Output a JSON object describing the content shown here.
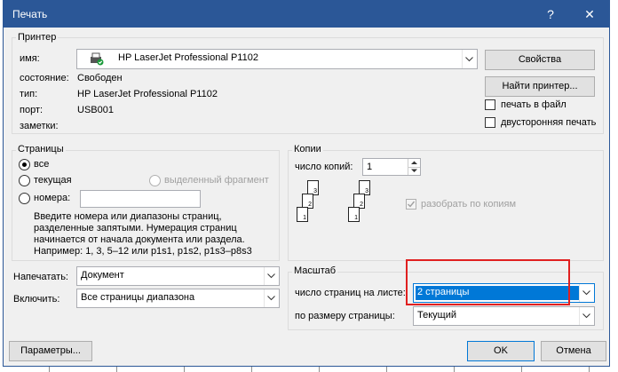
{
  "window": {
    "title": "Печать",
    "help": "?",
    "close": "✕"
  },
  "printer": {
    "group_title": "Принтер",
    "name_label": "имя:",
    "name_value": "HP LaserJet Professional P1102",
    "status_label": "состояние:",
    "status_value": "Свободен",
    "type_label": "тип:",
    "type_value": "HP LaserJet Professional P1102",
    "port_label": "порт:",
    "port_value": "USB001",
    "notes_label": "заметки:",
    "properties_button": "Свойства",
    "find_button": "Найти принтер...",
    "print_to_file_label": "печать в файл",
    "duplex_label": "двусторонняя печать"
  },
  "pages": {
    "group_title": "Страницы",
    "all_label": "все",
    "current_label": "текущая",
    "selection_label": "выделенный фрагмент",
    "numbers_label": "номера:",
    "numbers_value": "",
    "hint_lines": [
      "Введите номера или диапазоны страниц,",
      "разделенные запятыми. Нумерация страниц",
      "начинается от начала документа или раздела.",
      "Например: 1, 3, 5–12 или p1s1, p1s2, p1s3–p8s3"
    ]
  },
  "copies": {
    "group_title": "Копии",
    "count_label": "число копий:",
    "count_value": "1",
    "collate_label": "разобрать по копиям"
  },
  "print_what": {
    "label": "Напечатать:",
    "value": "Документ"
  },
  "include": {
    "label": "Включить:",
    "value": "Все страницы диапазона"
  },
  "zoom": {
    "group_title": "Масштаб",
    "pages_per_sheet_label": "число страниц на листе:",
    "pages_per_sheet_value": "2 страницы",
    "scale_label": "по размеру страницы:",
    "scale_value": "Текущий"
  },
  "footer": {
    "options_button": "Параметры...",
    "ok_button": "OK",
    "cancel_button": "Отмена"
  },
  "colors": {
    "titlebar": "#2b5797",
    "highlight": "#0078d7",
    "annotation": "#e02020"
  }
}
